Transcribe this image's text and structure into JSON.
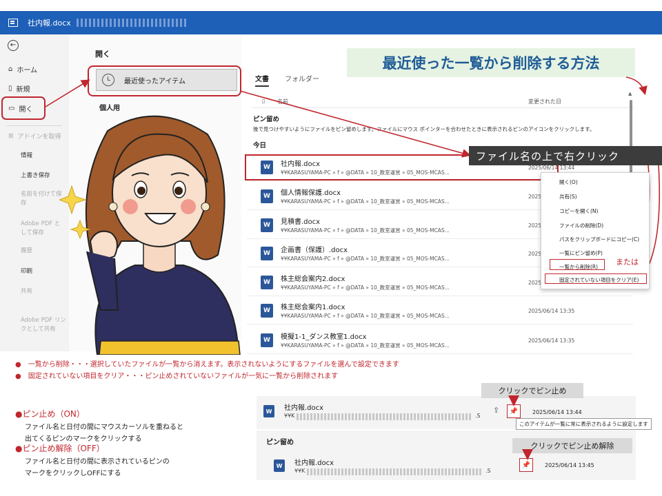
{
  "titlebar": {
    "doc_title": "社内報.docx"
  },
  "nav": {
    "items": [
      "ホーム",
      "新規",
      "開く",
      "アドインを取得",
      "情報",
      "上書き保存",
      "名前を付けて保存",
      "Adobe PDF として保存",
      "履歴",
      "印刷",
      "共有",
      "Adobe PDF リンクとして共有"
    ]
  },
  "open_panel": {
    "heading": "開く",
    "recent_button": "最近使ったアイテム",
    "personal": "個人用"
  },
  "content": {
    "tabs": [
      "文書",
      "フォルダー"
    ],
    "col_name": "名前",
    "col_modified": "変更された日",
    "pinned_title": "ピン留め",
    "pinned_desc": "後で見つけやすいようにファイルをピン留めします。ファイルにマウス ポインターを合わせたときに表示されるピンのアイコンをクリックします。",
    "today_title": "今日",
    "files": [
      {
        "name": "社内報.docx",
        "path": "¥¥KARASUYAMA-PC » f » @DATA » 10_教室運営 » 05_MOS-MCAS...",
        "date": "2025/06/14 13:44"
      },
      {
        "name": "個人情報保護.docx",
        "path": "¥¥KARASUYAMA-PC » f » @DATA » 10_教室運営 » 05_MOS-MCAS...",
        "date": "2025/06/14 13:40"
      },
      {
        "name": "見積書.docx",
        "path": "¥¥KARASUYAMA-PC » f » @DATA » 10_教室運営 » 05_MOS-MCAS...",
        "date": "2025/06/14 13:39"
      },
      {
        "name": "企画書（保護）.docx",
        "path": "¥¥KARASUYAMA-PC » f » @DATA » 10_教室運営 » 05_MOS-MCAS...",
        "date": "2025/06/14 13:38"
      },
      {
        "name": "株主総会案内2.docx",
        "path": "¥¥KARASUYAMA-PC » f » @DATA » 10_教室運営 » 05_MOS-MCAS...",
        "date": "2025/06/14 13:36"
      },
      {
        "name": "株主総会案内1.docx",
        "path": "¥¥KARASUYAMA-PC » f » @DATA » 10_教室運営 » 05_MOS-MCAS...",
        "date": "2025/06/14 13:35"
      },
      {
        "name": "模擬1-1_ダンス教室1.docx",
        "path": "¥¥KARASUYAMA-PC » f » @DATA » 10_教室運営 » 05_MOS-MCAS...",
        "date": "2025/06/14 13:35"
      }
    ]
  },
  "headline": "最近使った一覧から削除する方法",
  "callout": "ファイル名の上で右クリック",
  "context_menu": {
    "items": [
      "開く(O)",
      "共有(S)",
      "コピーを開く(N)",
      "ファイルの削除(D)",
      "パスをクリップボードにコピー(C)",
      "一覧にピン留め(P)",
      "一覧から削除(R)",
      "固定されていない項目をクリア(E)"
    ]
  },
  "or_label": "または",
  "explanations": {
    "line1": "●　一覧から削除・・・選択していたファイルが一覧から消えます。表示されないようにするファイルを選んで設定できます",
    "line2": "●　固定されていない項目をクリア・・・ピン止めされていないファイルが一気に一覧から削除されます",
    "pin_on_heading": "●ピン止め（ON）",
    "pin_on_text1": "ファイル名と日付の間にマウスカーソルを重ねると",
    "pin_on_text2": "出てくるピンのマークをクリックする",
    "pin_off_heading": "●ピン止め解除（OFF）",
    "pin_off_text1": "ファイル名と日付の間に表示されているピンの",
    "pin_off_text2": "マークをクリックしOFFにする"
  },
  "demo": {
    "top_label": "クリックでピン止め",
    "top_name": "社内報.docx",
    "top_path_a": "¥¥K",
    "top_path_b": ".S",
    "top_date": "2025/06/14 13:44",
    "tooltip": "このアイテムが一覧に常に表示されるように設定します",
    "pinned_title": "ピン留め",
    "bottom_label": "クリックでピン止め解除",
    "bottom_name": "社内報.docx",
    "bottom_path_a": "¥¥K",
    "bottom_path_b": ".S",
    "bottom_date": "2025/06/14 13:45"
  }
}
